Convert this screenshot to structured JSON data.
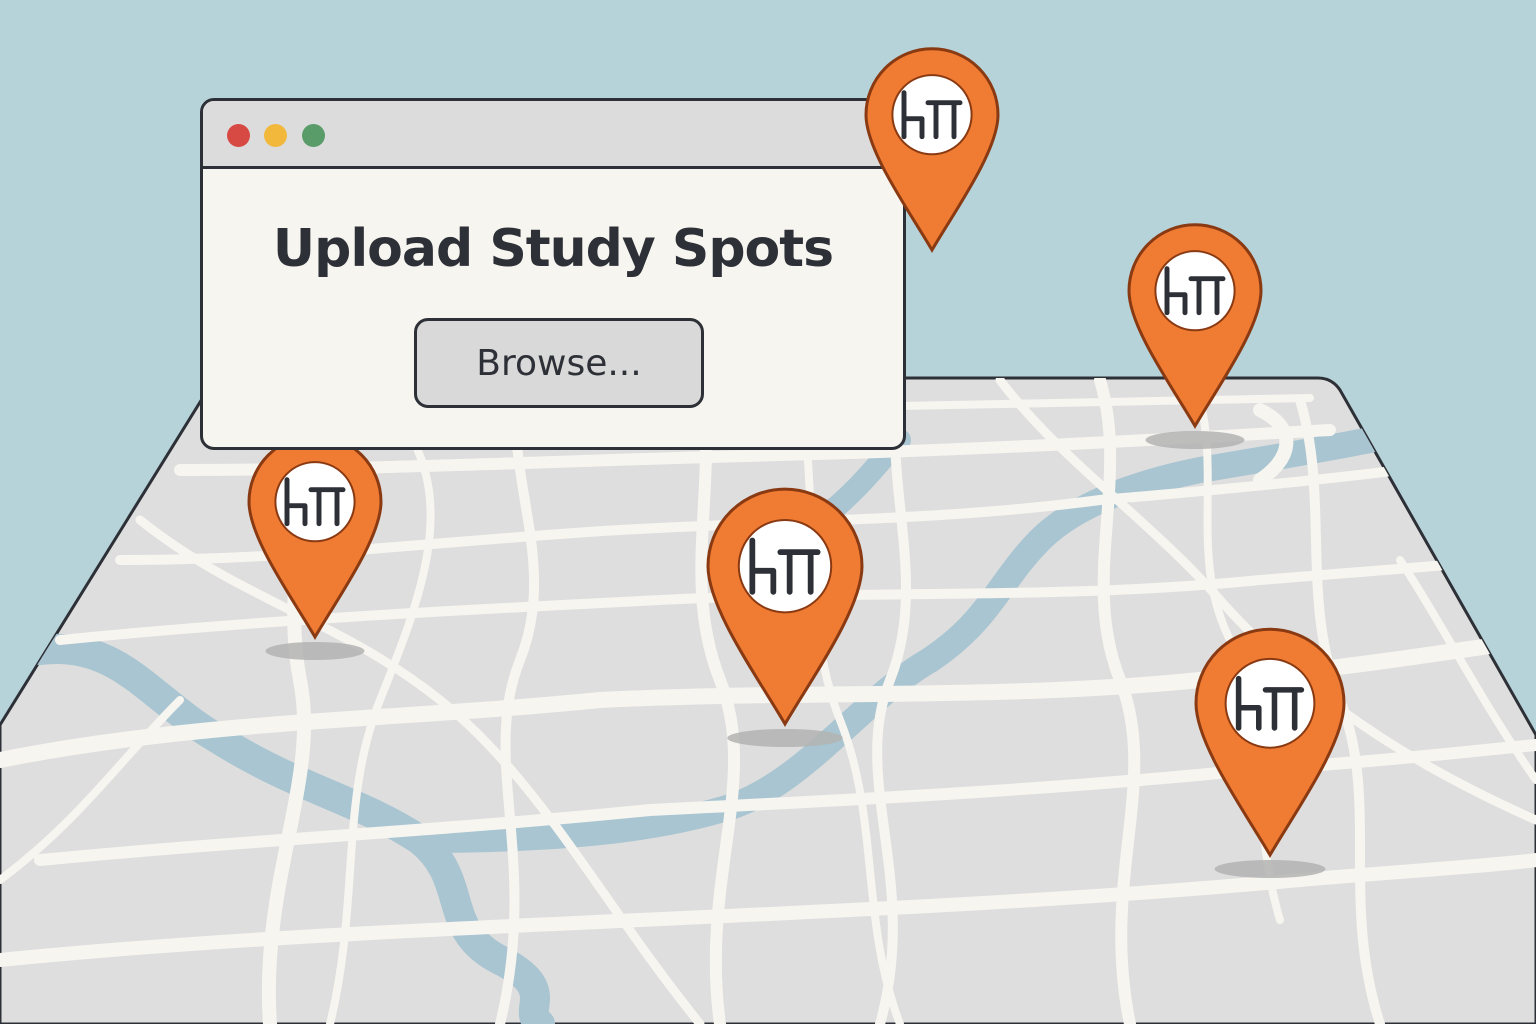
{
  "dialog": {
    "title": "Upload Study Spots",
    "browse_label": "Browse...",
    "window_controls": [
      "close",
      "minimize",
      "maximize"
    ]
  },
  "map": {
    "pin_icon": "desk-chair-icon",
    "pin_count": 5
  },
  "colors": {
    "sky": "#b6d3d9",
    "map_land": "#dedede",
    "roads": "#f7f5f0",
    "river": "#a8c5d1",
    "pin": "#f07b32",
    "outline": "#2d3036"
  }
}
